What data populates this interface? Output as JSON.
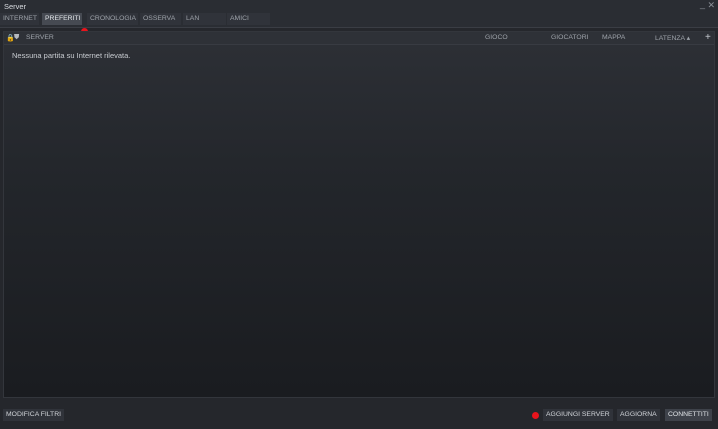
{
  "window": {
    "title": "Server",
    "minimize": "_",
    "close": "✕"
  },
  "tabs": [
    {
      "label": "INTERNET"
    },
    {
      "label": "PREFERITI"
    },
    {
      "label": "CRONOLOGIA"
    },
    {
      "label": "OSSERVA"
    },
    {
      "label": "LAN"
    },
    {
      "label": "AMICI"
    }
  ],
  "active_tab": "PREFERITI",
  "columns": {
    "lock_icon": "🔒",
    "shield_icon": "⛊",
    "server": "SERVER",
    "game": "GIOCO",
    "players": "GIOCATORI",
    "map": "MAPPA",
    "latency": "LATENZA ▴",
    "add": "+"
  },
  "empty_message": "Nessuna partita su Internet rilevata.",
  "footer": {
    "edit_filters": "MODIFICA FILTRI",
    "add_server": "AGGIUNGI SERVER",
    "refresh": "AGGIORNA",
    "connect": "CONNETTITI"
  },
  "colors": {
    "accent_dot": "#e8141c",
    "background": "#25272c",
    "panel": "#1e2025"
  }
}
